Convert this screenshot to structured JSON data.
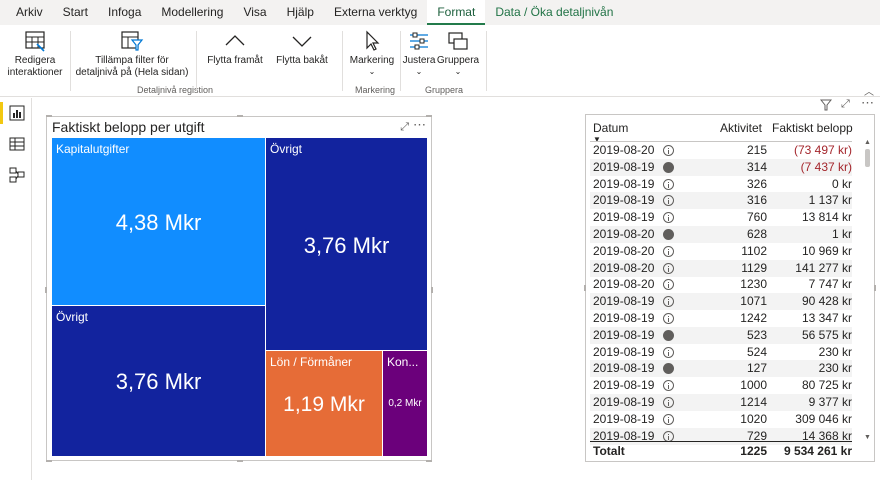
{
  "menu": {
    "items": [
      "Arkiv",
      "Start",
      "Infoga",
      "Modellering",
      "Visa",
      "Hjälp",
      "Externa verktyg",
      "Format",
      "Data / Öka detaljnivån"
    ],
    "active": "Format"
  },
  "ribbon": {
    "edit_interactions_line1": "Redigera",
    "edit_interactions_line2": "interaktioner",
    "apply_filter_line1": "Tillämpa filter för",
    "apply_filter_line2": "detaljnivå på (Hela sidan)",
    "group_drill": "Detaljnivå registion",
    "bring_forward": "Flytta framåt",
    "send_backward": "Flytta bakåt",
    "selection": "Markering",
    "group_selection": "Markering",
    "align": "Justera",
    "group": "Gruppera",
    "group_group": "Gruppera"
  },
  "treemap": {
    "title": "Faktiskt belopp per utgift",
    "tiles": [
      {
        "label": "Kapitalutgifter",
        "value": "4,38 Mkr",
        "color": "#118dff"
      },
      {
        "label": "Övrigt",
        "value": "3,76 Mkr",
        "color": "#12239e"
      },
      {
        "label": "Övrigt",
        "value": "3,76 Mkr",
        "color": "#12239e"
      },
      {
        "label": "Lön / Förmåner",
        "value": "1,19 Mkr",
        "color": "#e66c37"
      },
      {
        "label": "Kon...",
        "value": "0,2 Mkr",
        "color": "#6b007b"
      }
    ]
  },
  "table": {
    "headers": {
      "date": "Datum",
      "activity": "Aktivitet",
      "amount": "Faktiskt belopp"
    },
    "rows": [
      {
        "date": "2019-08-20",
        "icon": "outline",
        "activity": "215",
        "amount": "(73 497 kr)",
        "negative": true
      },
      {
        "date": "2019-08-19",
        "icon": "filled",
        "activity": "314",
        "amount": "(7 437 kr)",
        "negative": true
      },
      {
        "date": "2019-08-19",
        "icon": "outline",
        "activity": "326",
        "amount": "0 kr",
        "negative": false
      },
      {
        "date": "2019-08-19",
        "icon": "outline",
        "activity": "316",
        "amount": "1 137 kr",
        "negative": false
      },
      {
        "date": "2019-08-19",
        "icon": "outline",
        "activity": "760",
        "amount": "13 814 kr",
        "negative": false
      },
      {
        "date": "2019-08-20",
        "icon": "filled",
        "activity": "628",
        "amount": "1 kr",
        "negative": false
      },
      {
        "date": "2019-08-20",
        "icon": "outline",
        "activity": "1102",
        "amount": "10 969 kr",
        "negative": false
      },
      {
        "date": "2019-08-20",
        "icon": "outline",
        "activity": "1129",
        "amount": "141 277 kr",
        "negative": false
      },
      {
        "date": "2019-08-20",
        "icon": "outline",
        "activity": "1230",
        "amount": "7 747 kr",
        "negative": false
      },
      {
        "date": "2019-08-19",
        "icon": "outline",
        "activity": "1071",
        "amount": "90 428 kr",
        "negative": false
      },
      {
        "date": "2019-08-19",
        "icon": "outline",
        "activity": "1242",
        "amount": "13 347 kr",
        "negative": false
      },
      {
        "date": "2019-08-19",
        "icon": "filled",
        "activity": "523",
        "amount": "56 575 kr",
        "negative": false
      },
      {
        "date": "2019-08-19",
        "icon": "outline",
        "activity": "524",
        "amount": "230 kr",
        "negative": false
      },
      {
        "date": "2019-08-19",
        "icon": "filled",
        "activity": "127",
        "amount": "230 kr",
        "negative": false
      },
      {
        "date": "2019-08-19",
        "icon": "outline",
        "activity": "1000",
        "amount": "80 725 kr",
        "negative": false
      },
      {
        "date": "2019-08-19",
        "icon": "outline",
        "activity": "1214",
        "amount": "9 377 kr",
        "negative": false
      },
      {
        "date": "2019-08-19",
        "icon": "outline",
        "activity": "1020",
        "amount": "309 046 kr",
        "negative": false
      },
      {
        "date": "2019-08-19",
        "icon": "outline",
        "activity": "729",
        "amount": "14 368 kr",
        "negative": false
      }
    ],
    "total": {
      "label": "Totalt",
      "activity": "1225",
      "amount": "9 534 261 kr"
    }
  }
}
